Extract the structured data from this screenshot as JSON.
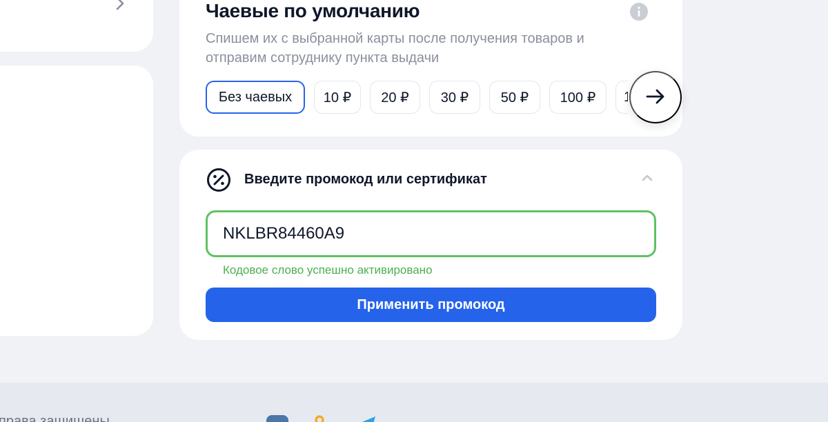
{
  "tips": {
    "title": "Чаевые по умолчанию",
    "description": "Спишем их с выбранной карты после получения товаров и отправим сотруднику пункта выдачи",
    "options": [
      "Без чаевых",
      "10 ₽",
      "20 ₽",
      "30 ₽",
      "50 ₽",
      "100 ₽",
      "1"
    ],
    "selected": "Без чаевых"
  },
  "promo": {
    "title": "Введите промокод или сертификат",
    "input_value": "NKLBR84460A9",
    "success_message": "Кодовое слово успешно активировано",
    "apply_label": "Применить промокод"
  },
  "footer": {
    "copyright": "права защищены"
  },
  "icons": {
    "info": "info-icon",
    "next": "arrow-right-icon",
    "promo": "percent-badge-icon",
    "collapse": "chevron-up-icon",
    "left_chevron": "chevron-right-icon",
    "social": [
      "vk-icon",
      "ok-icon",
      "telegram-icon"
    ]
  },
  "colors": {
    "accent": "#2563eb",
    "success": "#5fc162",
    "success_text": "#4caf50",
    "page_bg": "#f0f2f5",
    "footer_bg": "#e6e9ef"
  }
}
